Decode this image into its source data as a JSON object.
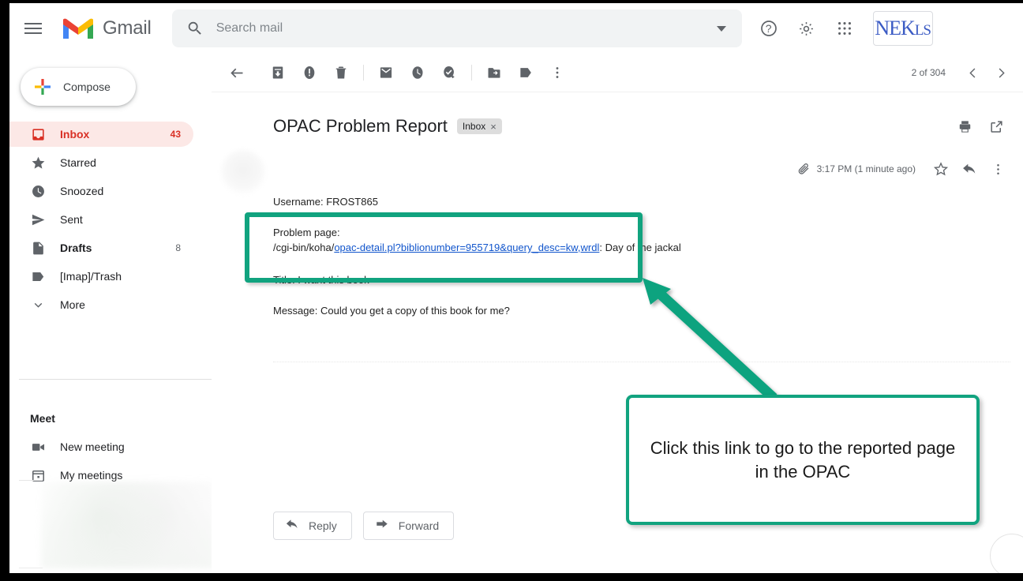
{
  "app": {
    "name": "Gmail",
    "hamburger_icon": "hamburger-menu-icon",
    "logo_icon": "gmail-m-logo-icon"
  },
  "search": {
    "placeholder": "Search mail",
    "value": "",
    "icon": "search-icon",
    "options_icon": "chevron-down-icon"
  },
  "header_actions": {
    "help": "help-circle-icon",
    "settings": "gear-icon",
    "apps": "apps-grid-icon",
    "account_initials": "NEK",
    "account_initials_small": "LS"
  },
  "sidebar": {
    "compose_label": "Compose",
    "compose_icon": "plus-icon",
    "items": [
      {
        "label": "Inbox",
        "count": "43",
        "icon": "inbox-icon",
        "active": true,
        "bold": true
      },
      {
        "label": "Starred",
        "count": "",
        "icon": "star-icon",
        "active": false,
        "bold": false
      },
      {
        "label": "Snoozed",
        "count": "",
        "icon": "clock-icon",
        "active": false,
        "bold": false
      },
      {
        "label": "Sent",
        "count": "",
        "icon": "send-icon",
        "active": false,
        "bold": false
      },
      {
        "label": "Drafts",
        "count": "8",
        "icon": "draft-icon",
        "active": false,
        "bold": true
      },
      {
        "label": "[Imap]/Trash",
        "count": "",
        "icon": "label-icon",
        "active": false,
        "bold": false
      },
      {
        "label": "More",
        "count": "",
        "icon": "chevron-down-icon",
        "active": false,
        "bold": false
      }
    ],
    "meet": {
      "title": "Meet",
      "items": [
        {
          "label": "New meeting",
          "icon": "video-camera-icon"
        },
        {
          "label": "My meetings",
          "icon": "calendar-icon"
        }
      ]
    }
  },
  "toolbar": {
    "icons": [
      "back-arrow-icon",
      "archive-icon",
      "report-spam-icon",
      "delete-icon",
      "mark-unread-icon",
      "snooze-icon",
      "add-to-tasks-icon",
      "move-to-icon",
      "labels-icon",
      "more-options-icon"
    ],
    "pagination": {
      "count_label": "2 of 304",
      "prev_icon": "chevron-left-icon",
      "next_icon": "chevron-right-icon"
    }
  },
  "email": {
    "subject": "OPAC Problem Report",
    "label_chip": "Inbox",
    "label_chip_remove": "×",
    "print_icon": "print-icon",
    "popout_icon": "open-in-new-icon",
    "attachment_icon": "paperclip-icon",
    "timestamp": "3:17 PM (1 minute ago)",
    "star_icon": "star-outline-icon",
    "reply_icon": "reply-arrow-icon",
    "more_icon": "more-vertical-icon",
    "body": {
      "username_line": "Username: FROST865",
      "problem_label": "Problem page:",
      "url_prefix": "/cgi-bin/koha/",
      "url_link": "opac-detail.pl?biblionumber=955719&query_desc=kw,wrdl",
      "url_suffix": ": Day of the jackal",
      "title_line": "Title: I want this book",
      "message_line": "Message: Could you get a copy of this book for me?"
    },
    "reply_button": "Reply",
    "forward_button": "Forward",
    "reply_button_icon": "reply-arrow-icon",
    "forward_button_icon": "forward-arrow-icon"
  },
  "annotation": {
    "callout_text": "Click this link to go to the reported page in the OPAC",
    "accent_color": "#11a37f",
    "highlight_target": "problem-page-link"
  }
}
